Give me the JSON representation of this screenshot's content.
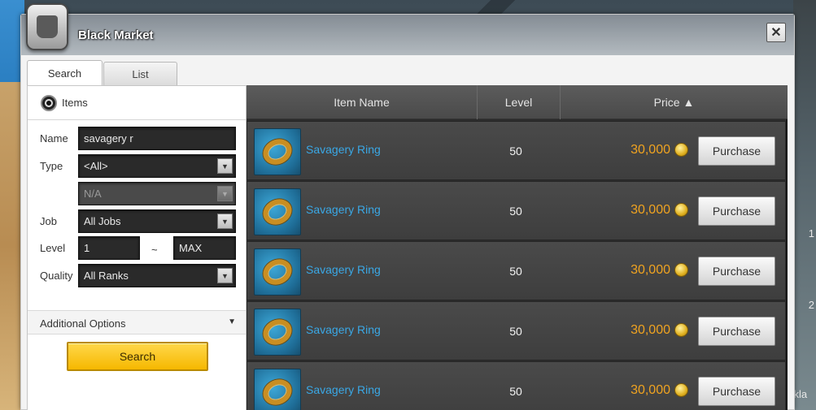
{
  "window": {
    "title": "Black Market",
    "close_label": "✕"
  },
  "tabs": [
    {
      "label": "Search",
      "active": true
    },
    {
      "label": "List",
      "active": false
    }
  ],
  "search_panel": {
    "mode_label": "Items",
    "fields": {
      "name": {
        "label": "Name",
        "value": "savagery r"
      },
      "type": {
        "label": "Type",
        "value": "<All>"
      },
      "subtype": {
        "value": "N/A"
      },
      "job": {
        "label": "Job",
        "value": "All Jobs"
      },
      "level": {
        "label": "Level",
        "min": "1",
        "separator": "~",
        "max": "MAX"
      },
      "quality": {
        "label": "Quality",
        "value": "All Ranks"
      }
    },
    "additional_options_label": "Additional Options",
    "search_button_label": "Search"
  },
  "results": {
    "columns": {
      "item_name": "Item Name",
      "level": "Level",
      "price": "Price ▲"
    },
    "rows": [
      {
        "name": "Savagery Ring",
        "level": "50",
        "price": "30,000",
        "action": "Purchase"
      },
      {
        "name": "Savagery Ring",
        "level": "50",
        "price": "30,000",
        "action": "Purchase"
      },
      {
        "name": "Savagery Ring",
        "level": "50",
        "price": "30,000",
        "action": "Purchase"
      },
      {
        "name": "Savagery Ring",
        "level": "50",
        "price": "30,000",
        "action": "Purchase"
      },
      {
        "name": "Savagery Ring",
        "level": "50",
        "price": "30,000",
        "action": "Purchase"
      }
    ]
  },
  "background_peek": {
    "right_1": "1",
    "right_2": "2",
    "right_3": "ckla"
  },
  "colors": {
    "item_name": "#3aa8e6",
    "price": "#f0a320",
    "search_button": "#f6b800"
  }
}
